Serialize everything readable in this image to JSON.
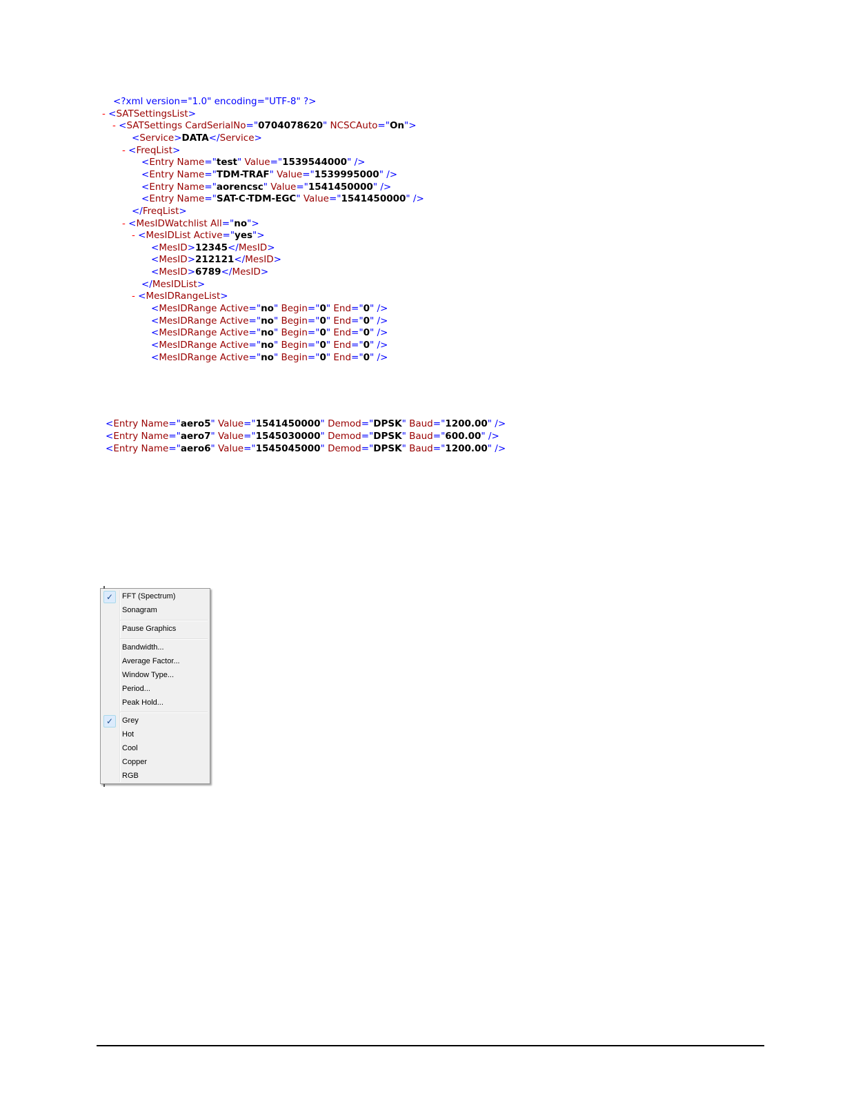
{
  "xml_tree": [
    [
      {
        "t": "<?xml version=\"1.0\" encoding=\"UTF-8\" ?>",
        "c": "b"
      }
    ],
    [
      {
        "t": "- ",
        "c": "m"
      },
      {
        "t": "<",
        "c": "b"
      },
      {
        "t": "SATSettingsList",
        "c": "r"
      },
      {
        "t": ">",
        "c": "b"
      }
    ],
    [
      {
        "t": "- ",
        "c": "m"
      },
      {
        "t": "<",
        "c": "b"
      },
      {
        "t": "SATSettings ",
        "c": "r"
      },
      {
        "t": "CardSerialNo",
        "c": "r"
      },
      {
        "t": "=\"",
        "c": "b"
      },
      {
        "t": "0704078620",
        "c": "k"
      },
      {
        "t": "\" ",
        "c": "b"
      },
      {
        "t": "NCSCAuto",
        "c": "r"
      },
      {
        "t": "=\"",
        "c": "b"
      },
      {
        "t": "On",
        "c": "k"
      },
      {
        "t": "\">",
        "c": "b"
      }
    ],
    [
      {
        "t": "<",
        "c": "b"
      },
      {
        "t": "Service",
        "c": "r"
      },
      {
        "t": ">",
        "c": "b"
      },
      {
        "t": "DATA",
        "c": "k"
      },
      {
        "t": "</",
        "c": "b"
      },
      {
        "t": "Service",
        "c": "r"
      },
      {
        "t": ">",
        "c": "b"
      }
    ],
    [
      {
        "t": "- ",
        "c": "m"
      },
      {
        "t": "<",
        "c": "b"
      },
      {
        "t": "FreqList",
        "c": "r"
      },
      {
        "t": ">",
        "c": "b"
      }
    ],
    [
      {
        "t": "<",
        "c": "b"
      },
      {
        "t": "Entry ",
        "c": "r"
      },
      {
        "t": "Name",
        "c": "r"
      },
      {
        "t": "=\"",
        "c": "b"
      },
      {
        "t": "test",
        "c": "k"
      },
      {
        "t": "\" ",
        "c": "b"
      },
      {
        "t": "Value",
        "c": "r"
      },
      {
        "t": "=\"",
        "c": "b"
      },
      {
        "t": "1539544000",
        "c": "k"
      },
      {
        "t": "\" />",
        "c": "b"
      }
    ],
    [
      {
        "t": "<",
        "c": "b"
      },
      {
        "t": "Entry ",
        "c": "r"
      },
      {
        "t": "Name",
        "c": "r"
      },
      {
        "t": "=\"",
        "c": "b"
      },
      {
        "t": "TDM-TRAF",
        "c": "k"
      },
      {
        "t": "\" ",
        "c": "b"
      },
      {
        "t": "Value",
        "c": "r"
      },
      {
        "t": "=\"",
        "c": "b"
      },
      {
        "t": "1539995000",
        "c": "k"
      },
      {
        "t": "\" />",
        "c": "b"
      }
    ],
    [
      {
        "t": "<",
        "c": "b"
      },
      {
        "t": "Entry ",
        "c": "r"
      },
      {
        "t": "Name",
        "c": "r"
      },
      {
        "t": "=\"",
        "c": "b"
      },
      {
        "t": "aorencsc",
        "c": "k"
      },
      {
        "t": "\" ",
        "c": "b"
      },
      {
        "t": "Value",
        "c": "r"
      },
      {
        "t": "=\"",
        "c": "b"
      },
      {
        "t": "1541450000",
        "c": "k"
      },
      {
        "t": "\" />",
        "c": "b"
      }
    ],
    [
      {
        "t": "<",
        "c": "b"
      },
      {
        "t": "Entry ",
        "c": "r"
      },
      {
        "t": "Name",
        "c": "r"
      },
      {
        "t": "=\"",
        "c": "b"
      },
      {
        "t": "SAT-C-TDM-EGC",
        "c": "k"
      },
      {
        "t": "\" ",
        "c": "b"
      },
      {
        "t": "Value",
        "c": "r"
      },
      {
        "t": "=\"",
        "c": "b"
      },
      {
        "t": "1541450000",
        "c": "k"
      },
      {
        "t": "\" />",
        "c": "b"
      }
    ],
    [
      {
        "t": "</",
        "c": "b"
      },
      {
        "t": "FreqList",
        "c": "r"
      },
      {
        "t": ">",
        "c": "b"
      }
    ],
    [
      {
        "t": "- ",
        "c": "m"
      },
      {
        "t": "<",
        "c": "b"
      },
      {
        "t": "MesIDWatchlist ",
        "c": "r"
      },
      {
        "t": "All",
        "c": "r"
      },
      {
        "t": "=\"",
        "c": "b"
      },
      {
        "t": "no",
        "c": "k"
      },
      {
        "t": "\">",
        "c": "b"
      }
    ],
    [
      {
        "t": "- ",
        "c": "m"
      },
      {
        "t": "<",
        "c": "b"
      },
      {
        "t": "MesIDList ",
        "c": "r"
      },
      {
        "t": "Active",
        "c": "r"
      },
      {
        "t": "=\"",
        "c": "b"
      },
      {
        "t": "yes",
        "c": "k"
      },
      {
        "t": "\">",
        "c": "b"
      }
    ],
    [
      {
        "t": "<",
        "c": "b"
      },
      {
        "t": "MesID",
        "c": "r"
      },
      {
        "t": ">",
        "c": "b"
      },
      {
        "t": "12345",
        "c": "k"
      },
      {
        "t": "</",
        "c": "b"
      },
      {
        "t": "MesID",
        "c": "r"
      },
      {
        "t": ">",
        "c": "b"
      }
    ],
    [
      {
        "t": "<",
        "c": "b"
      },
      {
        "t": "MesID",
        "c": "r"
      },
      {
        "t": ">",
        "c": "b"
      },
      {
        "t": "212121",
        "c": "k"
      },
      {
        "t": "</",
        "c": "b"
      },
      {
        "t": "MesID",
        "c": "r"
      },
      {
        "t": ">",
        "c": "b"
      }
    ],
    [
      {
        "t": "<",
        "c": "b"
      },
      {
        "t": "MesID",
        "c": "r"
      },
      {
        "t": ">",
        "c": "b"
      },
      {
        "t": "6789",
        "c": "k"
      },
      {
        "t": "</",
        "c": "b"
      },
      {
        "t": "MesID",
        "c": "r"
      },
      {
        "t": ">",
        "c": "b"
      }
    ],
    [
      {
        "t": "</",
        "c": "b"
      },
      {
        "t": "MesIDList",
        "c": "r"
      },
      {
        "t": ">",
        "c": "b"
      }
    ],
    [
      {
        "t": "- ",
        "c": "m"
      },
      {
        "t": "<",
        "c": "b"
      },
      {
        "t": "MesIDRangeList",
        "c": "r"
      },
      {
        "t": ">",
        "c": "b"
      }
    ],
    [
      {
        "t": "<",
        "c": "b"
      },
      {
        "t": "MesIDRange ",
        "c": "r"
      },
      {
        "t": "Active",
        "c": "r"
      },
      {
        "t": "=\"",
        "c": "b"
      },
      {
        "t": "no",
        "c": "k"
      },
      {
        "t": "\" ",
        "c": "b"
      },
      {
        "t": "Begin",
        "c": "r"
      },
      {
        "t": "=\"",
        "c": "b"
      },
      {
        "t": "0",
        "c": "k"
      },
      {
        "t": "\" ",
        "c": "b"
      },
      {
        "t": "End",
        "c": "r"
      },
      {
        "t": "=\"",
        "c": "b"
      },
      {
        "t": "0",
        "c": "k"
      },
      {
        "t": "\" />",
        "c": "b"
      }
    ],
    [
      {
        "t": "<",
        "c": "b"
      },
      {
        "t": "MesIDRange ",
        "c": "r"
      },
      {
        "t": "Active",
        "c": "r"
      },
      {
        "t": "=\"",
        "c": "b"
      },
      {
        "t": "no",
        "c": "k"
      },
      {
        "t": "\" ",
        "c": "b"
      },
      {
        "t": "Begin",
        "c": "r"
      },
      {
        "t": "=\"",
        "c": "b"
      },
      {
        "t": "0",
        "c": "k"
      },
      {
        "t": "\" ",
        "c": "b"
      },
      {
        "t": "End",
        "c": "r"
      },
      {
        "t": "=\"",
        "c": "b"
      },
      {
        "t": "0",
        "c": "k"
      },
      {
        "t": "\" />",
        "c": "b"
      }
    ],
    [
      {
        "t": "<",
        "c": "b"
      },
      {
        "t": "MesIDRange ",
        "c": "r"
      },
      {
        "t": "Active",
        "c": "r"
      },
      {
        "t": "=\"",
        "c": "b"
      },
      {
        "t": "no",
        "c": "k"
      },
      {
        "t": "\" ",
        "c": "b"
      },
      {
        "t": "Begin",
        "c": "r"
      },
      {
        "t": "=\"",
        "c": "b"
      },
      {
        "t": "0",
        "c": "k"
      },
      {
        "t": "\" ",
        "c": "b"
      },
      {
        "t": "End",
        "c": "r"
      },
      {
        "t": "=\"",
        "c": "b"
      },
      {
        "t": "0",
        "c": "k"
      },
      {
        "t": "\" />",
        "c": "b"
      }
    ],
    [
      {
        "t": "<",
        "c": "b"
      },
      {
        "t": "MesIDRange ",
        "c": "r"
      },
      {
        "t": "Active",
        "c": "r"
      },
      {
        "t": "=\"",
        "c": "b"
      },
      {
        "t": "no",
        "c": "k"
      },
      {
        "t": "\" ",
        "c": "b"
      },
      {
        "t": "Begin",
        "c": "r"
      },
      {
        "t": "=\"",
        "c": "b"
      },
      {
        "t": "0",
        "c": "k"
      },
      {
        "t": "\" ",
        "c": "b"
      },
      {
        "t": "End",
        "c": "r"
      },
      {
        "t": "=\"",
        "c": "b"
      },
      {
        "t": "0",
        "c": "k"
      },
      {
        "t": "\" />",
        "c": "b"
      }
    ],
    [
      {
        "t": "<",
        "c": "b"
      },
      {
        "t": "MesIDRange ",
        "c": "r"
      },
      {
        "t": "Active",
        "c": "r"
      },
      {
        "t": "=\"",
        "c": "b"
      },
      {
        "t": "no",
        "c": "k"
      },
      {
        "t": "\" ",
        "c": "b"
      },
      {
        "t": "Begin",
        "c": "r"
      },
      {
        "t": "=\"",
        "c": "b"
      },
      {
        "t": "0",
        "c": "k"
      },
      {
        "t": "\" ",
        "c": "b"
      },
      {
        "t": "End",
        "c": "r"
      },
      {
        "t": "=\"",
        "c": "b"
      },
      {
        "t": "0",
        "c": "k"
      },
      {
        "t": "\" />",
        "c": "b"
      }
    ]
  ],
  "xml_entries": [
    [
      {
        "t": "<",
        "c": "b"
      },
      {
        "t": "Entry ",
        "c": "r"
      },
      {
        "t": "Name",
        "c": "r"
      },
      {
        "t": "=\"",
        "c": "b"
      },
      {
        "t": "aero5",
        "c": "k"
      },
      {
        "t": "\" ",
        "c": "b"
      },
      {
        "t": "Value",
        "c": "r"
      },
      {
        "t": "=\"",
        "c": "b"
      },
      {
        "t": "1541450000",
        "c": "k"
      },
      {
        "t": "\" ",
        "c": "b"
      },
      {
        "t": "Demod",
        "c": "r"
      },
      {
        "t": "=\"",
        "c": "b"
      },
      {
        "t": "DPSK",
        "c": "k"
      },
      {
        "t": "\" ",
        "c": "b"
      },
      {
        "t": "Baud",
        "c": "r"
      },
      {
        "t": "=\"",
        "c": "b"
      },
      {
        "t": "1200.00",
        "c": "k"
      },
      {
        "t": "\" />",
        "c": "b"
      }
    ],
    [
      {
        "t": "<",
        "c": "b"
      },
      {
        "t": "Entry ",
        "c": "r"
      },
      {
        "t": "Name",
        "c": "r"
      },
      {
        "t": "=\"",
        "c": "b"
      },
      {
        "t": "aero7",
        "c": "k"
      },
      {
        "t": "\" ",
        "c": "b"
      },
      {
        "t": "Value",
        "c": "r"
      },
      {
        "t": "=\"",
        "c": "b"
      },
      {
        "t": "1545030000",
        "c": "k"
      },
      {
        "t": "\" ",
        "c": "b"
      },
      {
        "t": "Demod",
        "c": "r"
      },
      {
        "t": "=\"",
        "c": "b"
      },
      {
        "t": "DPSK",
        "c": "k"
      },
      {
        "t": "\" ",
        "c": "b"
      },
      {
        "t": "Baud",
        "c": "r"
      },
      {
        "t": "=\"",
        "c": "b"
      },
      {
        "t": "600.00",
        "c": "k"
      },
      {
        "t": "\" />",
        "c": "b"
      }
    ],
    [
      {
        "t": "<",
        "c": "b"
      },
      {
        "t": "Entry ",
        "c": "r"
      },
      {
        "t": "Name",
        "c": "r"
      },
      {
        "t": "=\"",
        "c": "b"
      },
      {
        "t": "aero6",
        "c": "k"
      },
      {
        "t": "\" ",
        "c": "b"
      },
      {
        "t": "Value",
        "c": "r"
      },
      {
        "t": "=\"",
        "c": "b"
      },
      {
        "t": "1545045000",
        "c": "k"
      },
      {
        "t": "\" ",
        "c": "b"
      },
      {
        "t": "Demod",
        "c": "r"
      },
      {
        "t": "=\"",
        "c": "b"
      },
      {
        "t": "DPSK",
        "c": "k"
      },
      {
        "t": "\" ",
        "c": "b"
      },
      {
        "t": "Baud",
        "c": "r"
      },
      {
        "t": "=\"",
        "c": "b"
      },
      {
        "t": "1200.00",
        "c": "k"
      },
      {
        "t": "\" />",
        "c": "b"
      }
    ]
  ],
  "context_menu": {
    "check_glyph": "✓",
    "items": [
      {
        "label": "FFT (Spectrum)",
        "checked": true
      },
      {
        "label": "Sonagram",
        "checked": false
      },
      {
        "label": "Pause Graphics",
        "checked": false
      },
      {
        "label": "Bandwidth...",
        "checked": false
      },
      {
        "label": "Average Factor...",
        "checked": false
      },
      {
        "label": "Window Type...",
        "checked": false
      },
      {
        "label": "Period...",
        "checked": false
      },
      {
        "label": "Peak Hold...",
        "checked": false
      },
      {
        "label": "Grey",
        "checked": true
      },
      {
        "label": "Hot",
        "checked": false
      },
      {
        "label": "Cool",
        "checked": false
      },
      {
        "label": "Copper",
        "checked": false
      },
      {
        "label": "RGB",
        "checked": false
      }
    ]
  },
  "colors": {
    "markup_blue": "#0000ff",
    "element_red": "#990000",
    "value_black": "#000000",
    "collapse_red": "#ff0000",
    "menu_background": "#f0f0f0"
  }
}
